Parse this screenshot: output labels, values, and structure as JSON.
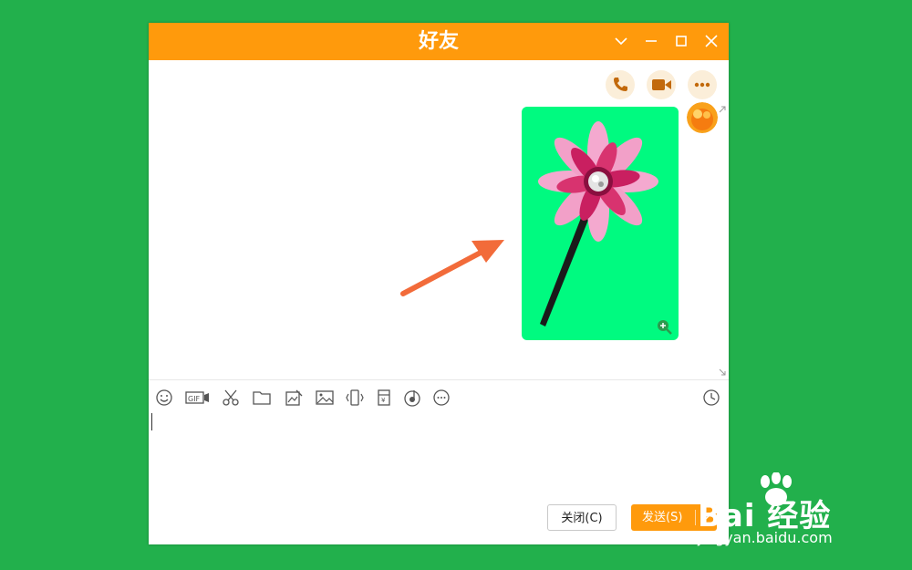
{
  "window": {
    "title": "好友"
  },
  "buttons": {
    "close_label": "关闭(C)",
    "send_label": "发送(S)"
  },
  "watermark": {
    "logo": "Bai 经验",
    "sub": "jingyan.baidu.com"
  },
  "icons": {
    "voice_call": "phone-icon",
    "video_call": "video-camera-icon",
    "more": "more-dots-icon",
    "toolbar": [
      "emoji-icon",
      "gif-icon",
      "scissors-icon",
      "folder-icon",
      "image-edit-icon",
      "image-icon",
      "shake-icon",
      "red-envelope-icon",
      "music-icon",
      "more-icon"
    ],
    "history": "clock-icon"
  },
  "colors": {
    "titlebar": "#ff9a0c",
    "desktop": "#22b04c",
    "image_bg": "#00fa80",
    "arrow": "#f26b3a",
    "send_button": "#ff9a0c"
  }
}
